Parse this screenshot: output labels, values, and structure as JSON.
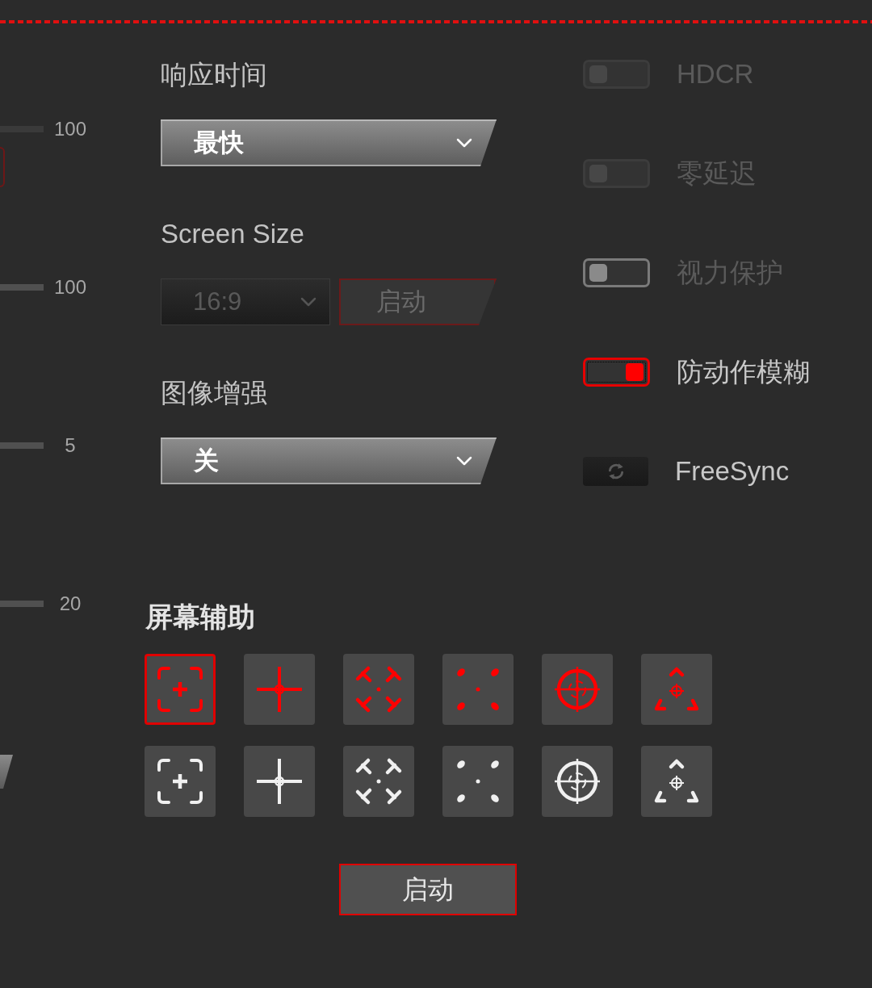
{
  "sliders": [
    {
      "reading": "100"
    },
    {
      "reading": "100"
    },
    {
      "reading": "5"
    },
    {
      "reading": "20"
    }
  ],
  "settings": [
    {
      "kind": "dropdown",
      "label": "响应时间",
      "value": "最快",
      "disabled": false
    },
    {
      "kind": "dropdown_with_button",
      "label": "Screen Size",
      "value": "16:9",
      "disabled": true,
      "button": {
        "label": "启动",
        "disabled": true
      }
    },
    {
      "kind": "dropdown",
      "label": "图像增强",
      "value": "关",
      "disabled": false
    }
  ],
  "toggles": [
    {
      "kind": "switch",
      "label": "HDCR",
      "on": false,
      "disabled": true,
      "focused": false
    },
    {
      "kind": "switch",
      "label": "零延迟",
      "on": false,
      "disabled": true,
      "focused": false
    },
    {
      "kind": "switch",
      "label": "视力保护",
      "on": false,
      "disabled": false,
      "focused": false
    },
    {
      "kind": "switch",
      "label": "防动作模糊",
      "on": true,
      "disabled": false,
      "focused": true
    },
    {
      "kind": "sync_button",
      "label": "FreeSync"
    }
  ],
  "screen_assist": {
    "title": "屏幕辅助",
    "crosshairs": [
      {
        "kind": "corners",
        "color": "#ff0000",
        "selected": true
      },
      {
        "kind": "cross",
        "color": "#ff0000",
        "selected": false
      },
      {
        "kind": "arrows",
        "color": "#ff0000",
        "selected": false
      },
      {
        "kind": "dots",
        "color": "#ff0000",
        "selected": false
      },
      {
        "kind": "scope",
        "color": "#ff0000",
        "selected": false
      },
      {
        "kind": "triangle",
        "color": "#ff0000",
        "selected": false
      },
      {
        "kind": "corners",
        "color": "#f0f0f0",
        "selected": false
      },
      {
        "kind": "cross",
        "color": "#f0f0f0",
        "selected": false
      },
      {
        "kind": "arrows",
        "color": "#f0f0f0",
        "selected": false
      },
      {
        "kind": "dots",
        "color": "#f0f0f0",
        "selected": false
      },
      {
        "kind": "scope",
        "color": "#f0f0f0",
        "selected": false
      },
      {
        "kind": "triangle",
        "color": "#f0f0f0",
        "selected": false
      }
    ],
    "start_button": "启动"
  }
}
